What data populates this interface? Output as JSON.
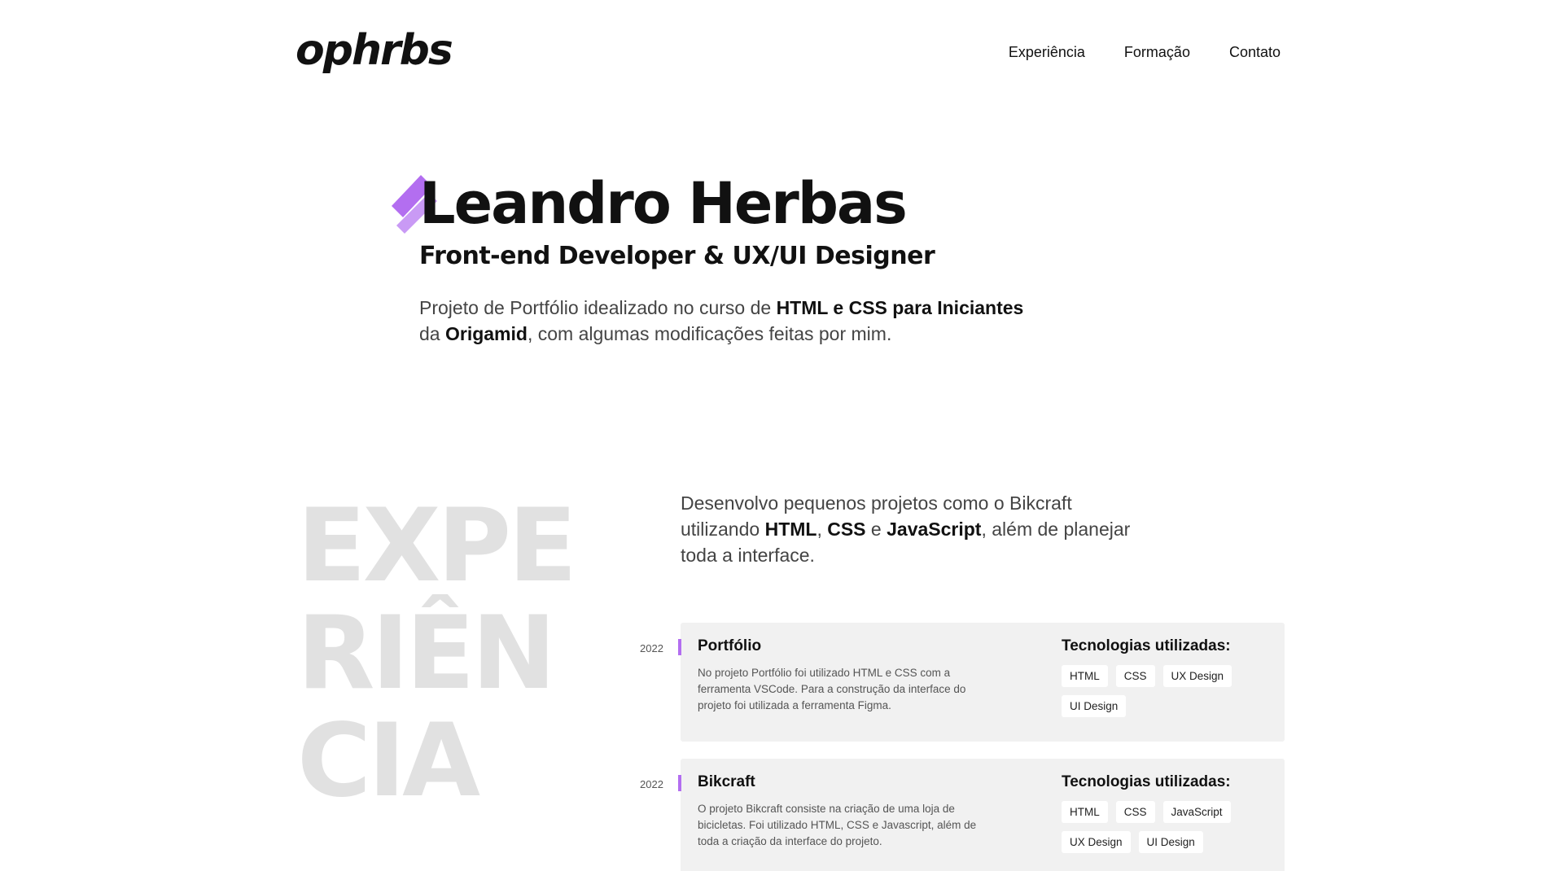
{
  "header": {
    "logo": "ophrbs",
    "nav": [
      "Experiência",
      "Formação",
      "Contato"
    ]
  },
  "hero": {
    "name": "Leandro Herbas",
    "role": "Front-end Developer & UX/UI Designer",
    "intro": {
      "t1": "Projeto de Portfólio idealizado no curso de ",
      "b1": "HTML e CSS para Iniciantes",
      "t2": " da ",
      "b2": "Origamid",
      "t3": ", com algumas modificações feitas por mim."
    }
  },
  "experience": {
    "big_word": [
      "EXPE",
      "RIÊN",
      "CIA"
    ],
    "intro": {
      "t1": "Desenvolvo pequenos projetos como o Bikcraft utilizando ",
      "b1": "HTML",
      "t2": ", ",
      "b2": "CSS",
      "t3": " e ",
      "b3": "JavaScript",
      "t4": ", além de planejar toda a interface."
    },
    "jobs": [
      {
        "year": "2022",
        "title": "Portfólio",
        "description": "No projeto Portfólio foi utilizado HTML e CSS com a ferramenta VSCode. Para a construção da interface do projeto foi utilizada a ferramenta Figma.",
        "tech_title": "Tecnologias utilizadas:",
        "tags": [
          "HTML",
          "CSS",
          "UX Design",
          "UI Design"
        ]
      },
      {
        "year": "2022",
        "title": "Bikcraft",
        "description": "O projeto Bikcraft consiste na criação de uma loja de bicicletas. Foi utilizado HTML, CSS e Javascript, além de toda a criação da interface do projeto.",
        "tech_title": "Tecnologias utilizadas:",
        "tags": [
          "HTML",
          "CSS",
          "JavaScript",
          "UX Design",
          "UI Design"
        ]
      }
    ]
  },
  "colors": {
    "accent": "#b36ef0",
    "card_bg": "#f1f1f1",
    "big_word": "#e1e1e1"
  }
}
